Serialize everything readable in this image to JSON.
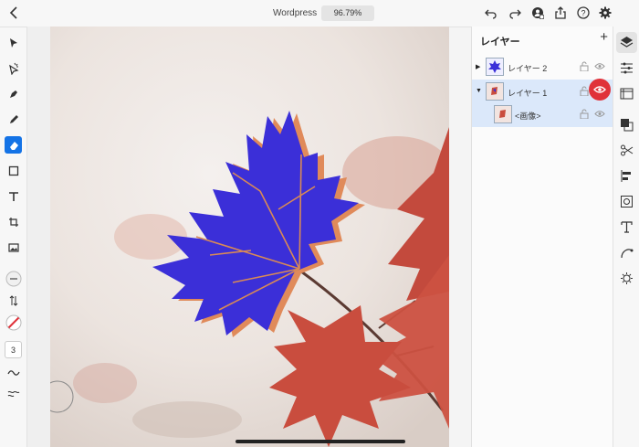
{
  "header": {
    "doc_title": "Wordpress",
    "zoom": "96.79%"
  },
  "layers_panel": {
    "title": "レイヤー",
    "add": "+",
    "layers": [
      {
        "label": "レイヤー 2"
      },
      {
        "label": "レイヤー 1"
      },
      {
        "label": "<画像>"
      }
    ]
  },
  "left_tools": {
    "brush_size": "3"
  },
  "colors": {
    "accent": "#1473e6",
    "leaf_fill": "#3b2fd8",
    "highlight": "#e0323a"
  }
}
